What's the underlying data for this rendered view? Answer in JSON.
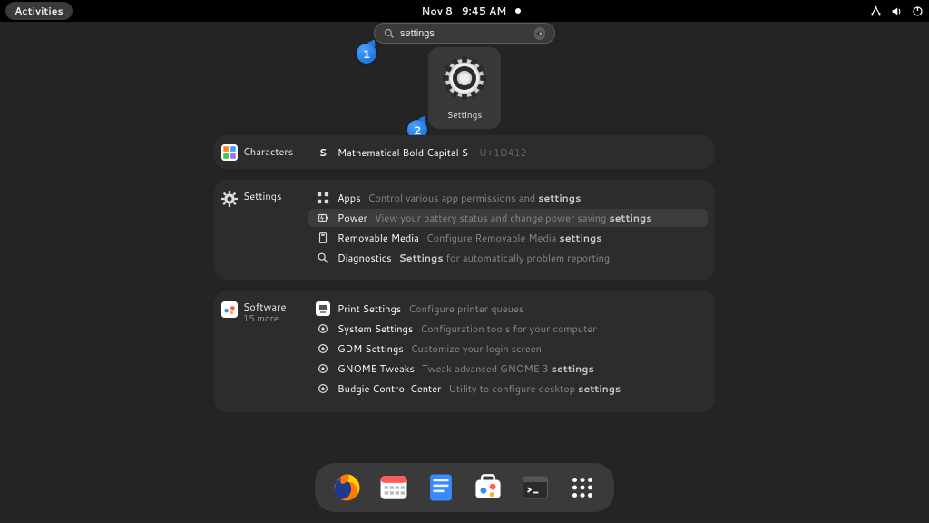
{
  "topbar": {
    "activities": "Activities",
    "date": "Nov 8",
    "time": "9:45 AM"
  },
  "search": {
    "query": "settings"
  },
  "callouts": {
    "one": "1",
    "two": "2"
  },
  "main_app": {
    "label": "Settings"
  },
  "sections": {
    "characters": {
      "title": "Characters",
      "row": {
        "glyph": "S",
        "name": "Mathematical Bold Capital S",
        "code": "U+1D412"
      }
    },
    "settings": {
      "title": "Settings",
      "rows": {
        "apps": {
          "name": "Apps",
          "desc_pre": "Control various app permissions and ",
          "desc_bold": "settings",
          "desc_post": ""
        },
        "power": {
          "name": "Power",
          "desc_pre": "View your battery status and change power saving ",
          "desc_bold": "settings",
          "desc_post": ""
        },
        "removable": {
          "name": "Removable Media",
          "desc_pre": "Configure Removable Media ",
          "desc_bold": "settings",
          "desc_post": ""
        },
        "diagnostics": {
          "name": "Diagnostics",
          "desc_pre": "",
          "desc_bold": "Settings",
          "desc_post": " for automatically problem reporting"
        }
      }
    },
    "software": {
      "title": "Software",
      "sub": "15 more",
      "rows": {
        "print": {
          "name": "Print Settings",
          "desc_pre": "Configure printer queues",
          "desc_bold": "",
          "desc_post": ""
        },
        "system": {
          "name": "System Settings",
          "desc_pre": "Configuration tools for your computer",
          "desc_bold": "",
          "desc_post": ""
        },
        "gdm": {
          "name": "GDM Settings",
          "desc_pre": "Customize your login screen",
          "desc_bold": "",
          "desc_post": ""
        },
        "tweaks": {
          "name": "GNOME Tweaks",
          "desc_pre": "Tweak advanced GNOME 3 ",
          "desc_bold": "settings",
          "desc_post": ""
        },
        "budgie": {
          "name": "Budgie Control Center",
          "desc_pre": "Utility to configure desktop ",
          "desc_bold": "settings",
          "desc_post": ""
        }
      }
    }
  },
  "dock": {
    "items": [
      "firefox",
      "calendar",
      "todo",
      "software",
      "terminal",
      "app-grid"
    ]
  }
}
